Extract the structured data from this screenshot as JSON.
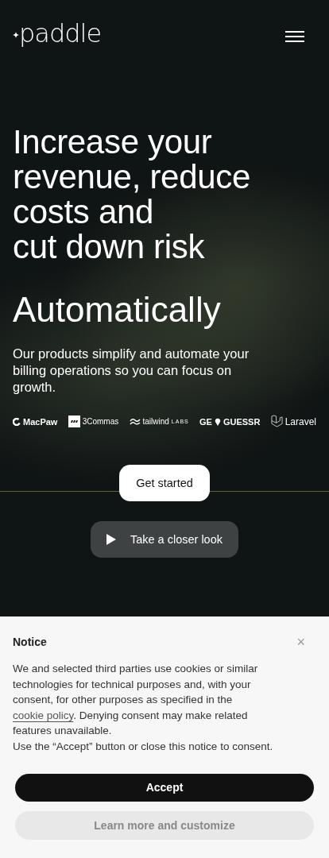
{
  "header": {
    "logo": "paddle"
  },
  "hero": {
    "headline_lines": [
      "Increase your",
      "revenue, reduce",
      "costs and",
      "cut down risk"
    ],
    "tagline": "Automatically",
    "subtitle": "Our products simplify and automate your billing operations so you can focus on growth.",
    "logos": [
      {
        "kind": "macpaw",
        "text": "MacPaw"
      },
      {
        "kind": "threecommas",
        "text": "3Commas"
      },
      {
        "kind": "tailwind",
        "text": "tailwind",
        "suffix": "LABS"
      },
      {
        "kind": "geoguessr",
        "text": "GE",
        "suffix": "GUESSR"
      },
      {
        "kind": "laravel",
        "text": "Laravel"
      }
    ],
    "primary_button": "Get started",
    "video_button": "Take a closer look"
  },
  "notice": {
    "title": "Notice",
    "close": "×",
    "body_before": "We and selected third parties use cookies or similar technologies for technical purposes and, with your consent, for other purposes as specified in the ",
    "link": "cookie policy",
    "body_after": ". Denying consent may make related features unavailable.",
    "body_2": "Use the “Accept” button or close this notice to consent.",
    "accept": "Accept",
    "customize": "Learn more and customize"
  }
}
